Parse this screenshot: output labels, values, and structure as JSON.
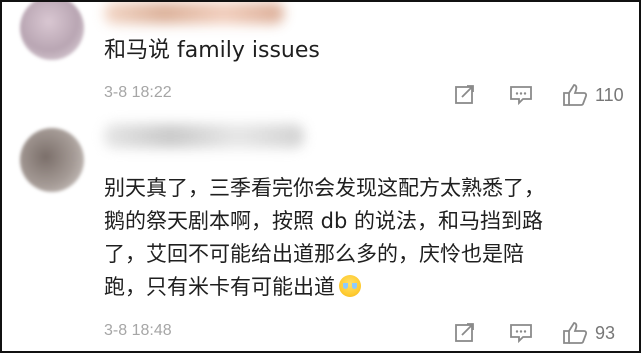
{
  "comments": [
    {
      "text": "和马说 family issues",
      "timestamp": "3-8 18:22",
      "like_count": "110"
    },
    {
      "line1": "别天真了，三季看完你会发现这配方太熟悉了，",
      "line2": "鹅的祭天剧本啊，按照 db 的说法，和马挡到路",
      "line3": "了，艾回不可能给出道那么多的，庆怜也是陪",
      "line4": "跑，只有米卡有可能出道",
      "timestamp": "3-8 18:48",
      "like_count": "93"
    }
  ],
  "icons": {
    "share": "share-icon",
    "reply": "comment-icon",
    "like": "thumbs-up-icon",
    "emoji": "crying-face-emoji"
  },
  "colors": {
    "text": "#1f1f1f",
    "meta": "#a6a6a6",
    "icon": "#8a8a8a",
    "border": "#111111"
  }
}
